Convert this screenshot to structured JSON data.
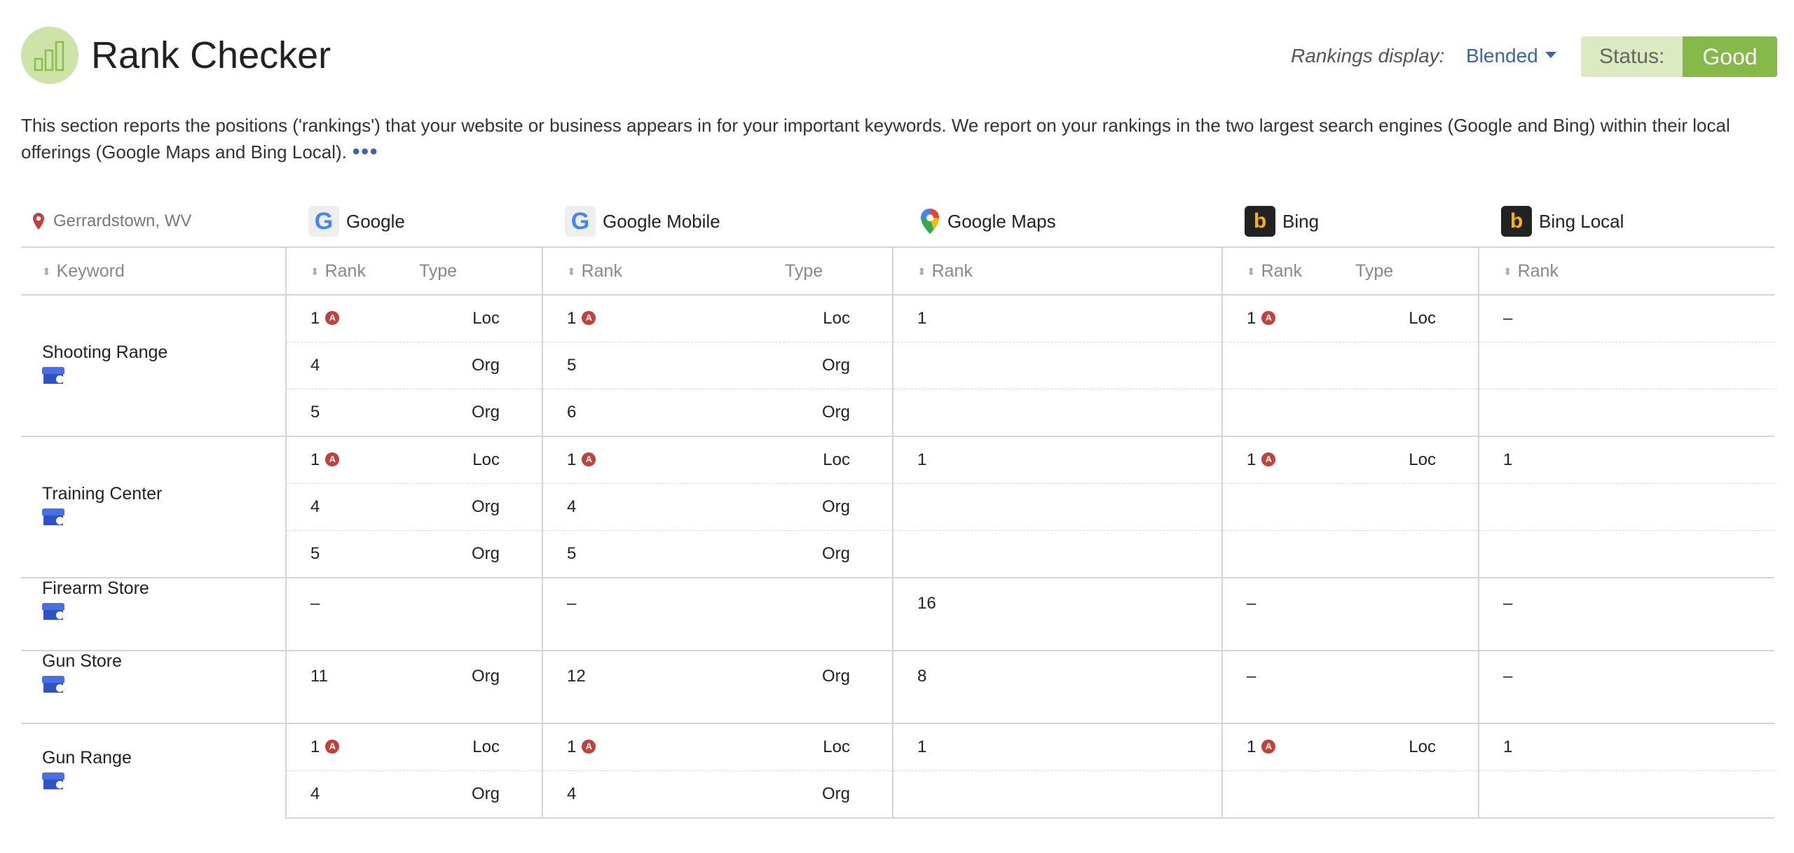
{
  "header": {
    "title": "Rank Checker",
    "rankings_display_label": "Rankings display:",
    "rankings_display_value": "Blended",
    "status_label": "Status:",
    "status_value": "Good"
  },
  "intro": {
    "text": "This section reports the positions ('rankings') that your website or business appears in for your important keywords. We report on your rankings in the two largest search engines (Google and Bing) within their local offerings (Google Maps and Bing Local).",
    "more": "•••"
  },
  "location": "Gerrardstown, WV",
  "engines": [
    {
      "name": "Google",
      "icon": "google-icon"
    },
    {
      "name": "Google Mobile",
      "icon": "google-icon"
    },
    {
      "name": "Google Maps",
      "icon": "google-maps-pin-icon"
    },
    {
      "name": "Bing",
      "icon": "bing-icon"
    },
    {
      "name": "Bing Local",
      "icon": "bing-icon"
    }
  ],
  "columns": {
    "keyword": "Keyword",
    "rank": "Rank",
    "type": "Type"
  },
  "advertiser_badge": "A",
  "colors": {
    "accent_blue": "#3d63b0",
    "status_good": "#86b84a",
    "badge_red": "#c0423c"
  },
  "keywords": [
    {
      "name": "Shooting Range",
      "rows": [
        {
          "g": "1",
          "g_ad": true,
          "g_t": "Loc",
          "gm": "1",
          "gm_ad": true,
          "gm_t": "Loc",
          "maps": "1",
          "b": "1",
          "b_ad": true,
          "b_t": "Loc",
          "bl": "–"
        },
        {
          "g": "4",
          "g_t": "Org",
          "gm": "5",
          "gm_t": "Org"
        },
        {
          "g": "5",
          "g_t": "Org",
          "gm": "6",
          "gm_t": "Org"
        }
      ]
    },
    {
      "name": "Training Center",
      "rows": [
        {
          "g": "1",
          "g_ad": true,
          "g_t": "Loc",
          "gm": "1",
          "gm_ad": true,
          "gm_t": "Loc",
          "maps": "1",
          "b": "1",
          "b_ad": true,
          "b_t": "Loc",
          "bl": "1"
        },
        {
          "g": "4",
          "g_t": "Org",
          "gm": "4",
          "gm_t": "Org"
        },
        {
          "g": "5",
          "g_t": "Org",
          "gm": "5",
          "gm_t": "Org"
        }
      ]
    },
    {
      "name": "Firearm Store",
      "rows": [
        {
          "g": "–",
          "gm": "–",
          "maps": "16",
          "b": "–",
          "bl": "–"
        }
      ]
    },
    {
      "name": "Gun Store",
      "rows": [
        {
          "g": "11",
          "g_t": "Org",
          "gm": "12",
          "gm_t": "Org",
          "maps": "8",
          "b": "–",
          "bl": "–"
        }
      ]
    },
    {
      "name": "Gun Range",
      "rows": [
        {
          "g": "1",
          "g_ad": true,
          "g_t": "Loc",
          "gm": "1",
          "gm_ad": true,
          "gm_t": "Loc",
          "maps": "1",
          "b": "1",
          "b_ad": true,
          "b_t": "Loc",
          "bl": "1"
        },
        {
          "g": "4",
          "g_t": "Org",
          "gm": "4",
          "gm_t": "Org"
        }
      ]
    }
  ]
}
